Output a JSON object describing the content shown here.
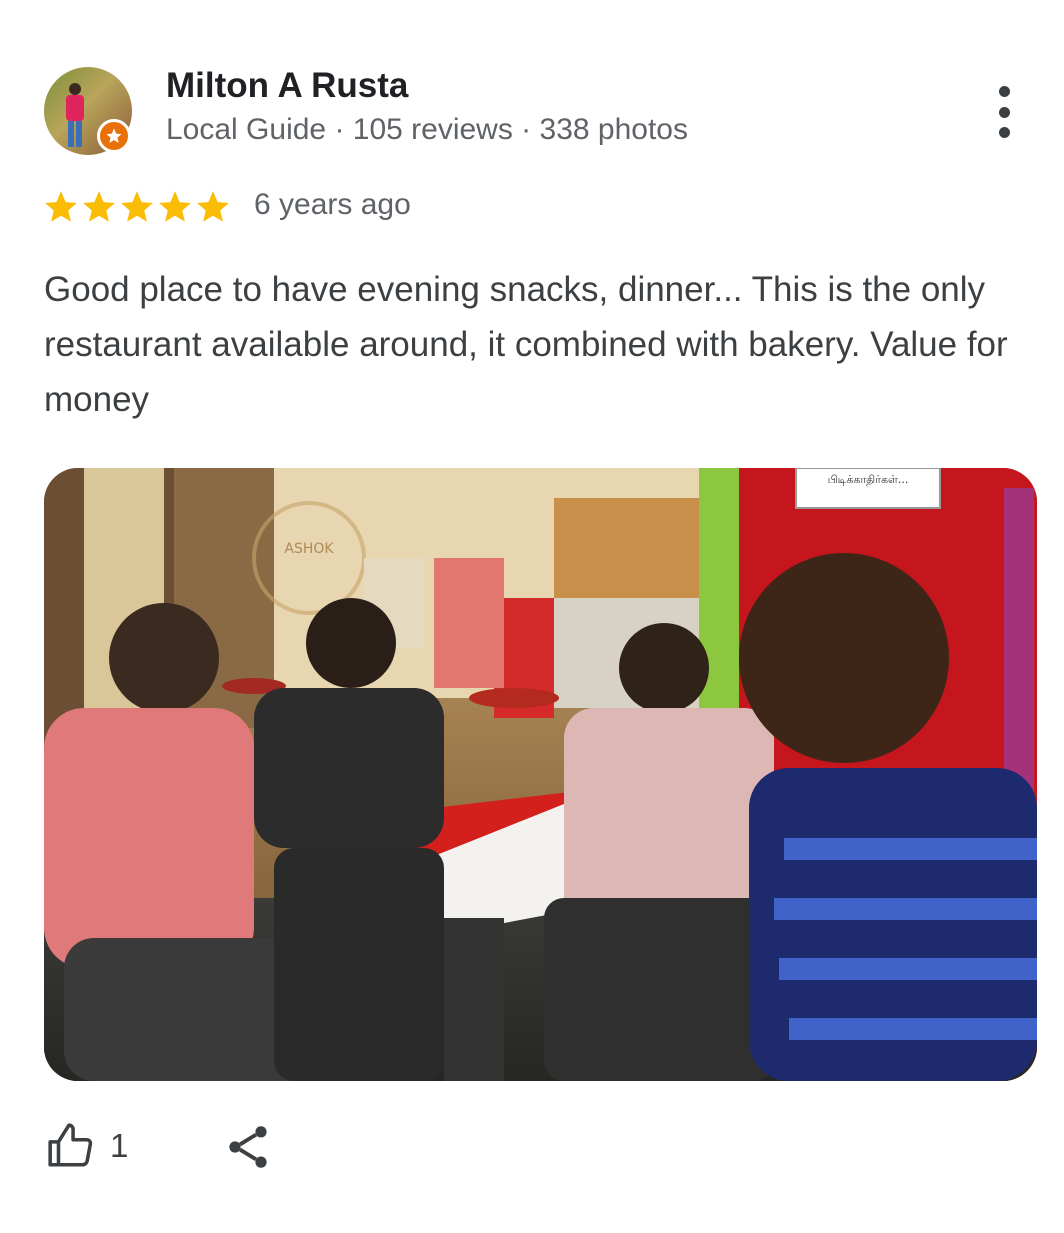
{
  "review": {
    "reviewer": {
      "name": "Milton A Rusta",
      "meta": "Local Guide · 105 reviews · 338 photos",
      "avatar_icon": "person-photo-avatar",
      "badge_icon": "local-guide-star-badge"
    },
    "rating": 5,
    "time_ago": "6 years ago",
    "text": "Good place to have evening snacks, dinner... This is the only restaurant available around, it combined with bakery. Value for money",
    "photo": {
      "sign_text": "பிடிக்காதிர்கள்...",
      "logo_text": "ASHOK"
    },
    "actions": {
      "like_icon": "thumbs-up-icon",
      "like_count": "1",
      "share_icon": "share-icon",
      "more_icon": "more-vertical-icon"
    }
  },
  "colors": {
    "star": "#FBBC04",
    "badge": "#E8710A",
    "text_primary": "#202124",
    "text_secondary": "#5F6368"
  }
}
